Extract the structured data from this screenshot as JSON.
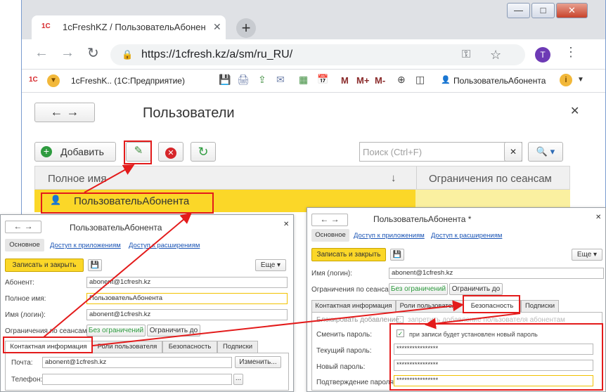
{
  "browser": {
    "tab_title": "1cFreshKZ / ПользовательАбонен",
    "tab_icon": "1С",
    "url": "https://1cfresh.kz/a/sm/ru_RU/",
    "profile_initial": "T"
  },
  "bookmarks": {
    "app_name": "1cFreshK.. (1С:Предприятие)",
    "m": "M",
    "m_plus": "M+",
    "m_minus": "M-",
    "user": "ПользовательАбонента"
  },
  "main": {
    "title": "Пользователи",
    "add_label": "Добавить",
    "search_placeholder": "Поиск (Ctrl+F)",
    "columns": [
      "Полное имя",
      "Ограничения по сеансам"
    ],
    "sort_arrow": "↓",
    "row_name": "ПользовательАбонента"
  },
  "dialog1": {
    "title": "ПользовательАбонента",
    "tabs": [
      "Основное",
      "Доступ к приложениям",
      "Доступ к расширениям"
    ],
    "save_close": "Записать и закрыть",
    "more": "Еще",
    "fields": {
      "subscriber_label": "Абонент:",
      "subscriber_value": "abonent@1cfresh.kz",
      "fullname_label": "Полное имя:",
      "fullname_value": "ПользовательАбонента",
      "login_label": "Имя (логин):",
      "login_value": "abonent@1cfresh.kz",
      "session_label": "Ограничения по сеансам:",
      "no_limits": "Без ограничений",
      "limit_to": "Ограничить до"
    },
    "form_tabs": [
      "Контактная информация",
      "Роли пользователя",
      "Безопасность",
      "Подписки"
    ],
    "email_label": "Почта:",
    "email_value": "abonent@1cfresh.kz",
    "change": "Изменить...",
    "phone_label": "Телефон:",
    "dots": "..."
  },
  "dialog2": {
    "title": "ПользовательАбонента *",
    "tabs": [
      "Основное",
      "Доступ к приложениям",
      "Доступ к расширениям"
    ],
    "save_close": "Записать и закрыть",
    "more": "Еще",
    "login_label": "Имя (логин):",
    "login_value": "abonent@1cfresh.kz",
    "session_label": "Ограничения по сеансам:",
    "no_limits": "Без ограничений",
    "limit_to": "Ограничить до",
    "form_tabs": [
      "Контактная информация",
      "Роли пользователя",
      "Безопасность",
      "Подписки"
    ],
    "block_label": "Блокировать добавление:",
    "block_text": "запретить добавление пользователя абонентам",
    "change_pwd_label": "Сменить пароль:",
    "change_pwd_text": "при записи будет установлен новый пароль",
    "current_pwd_label": "Текущий пароль:",
    "current_pwd_value": "****************",
    "new_pwd_label": "Новый пароль:",
    "new_pwd_value": "****************",
    "confirm_pwd_label": "Подтверждение пароля:",
    "confirm_pwd_value": "****************"
  },
  "colors": {
    "accent": "#e31b1b",
    "yellow": "#fbd728",
    "green": "#2e9b3f",
    "link": "#1a54b5"
  }
}
